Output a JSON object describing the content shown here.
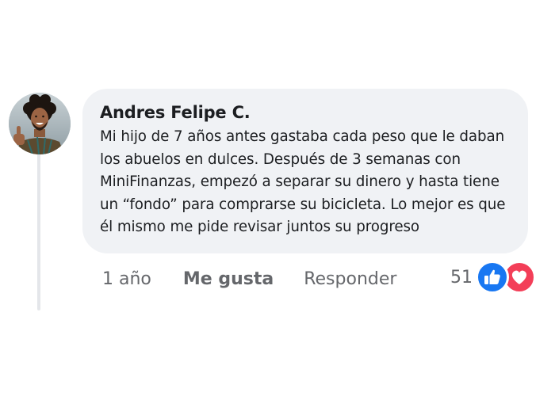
{
  "comment": {
    "author": "Andres Felipe C.",
    "text": "Mi hijo de 7 años antes gastaba cada peso que le daban\nlos abuelos en dulces. Después de 3 semanas con\nMiniFinanzas, empezó a separar su dinero y hasta tiene\nun “fondo” para comprarse su bicicleta. Lo mejor es que\nél mismo me pide revisar juntos su progreso",
    "avatar_icon": "user-avatar-photo"
  },
  "actions": {
    "time": "1 año",
    "like_label": "Me gusta",
    "reply_label": "Responder"
  },
  "reactions": {
    "count": "51",
    "icons": [
      "like-icon",
      "love-icon"
    ],
    "like_color": "#1877f2",
    "love_color": "#f33e58"
  }
}
